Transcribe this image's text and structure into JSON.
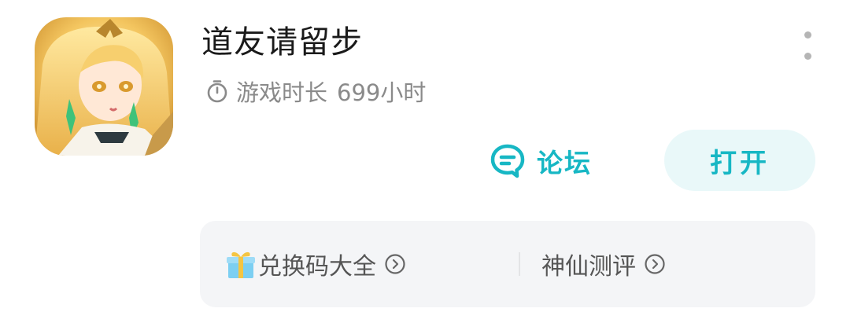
{
  "app": {
    "title": "道友请留步",
    "icon": "game-character-portrait",
    "playtime_label": "游戏时长",
    "playtime_value": "699小时"
  },
  "actions": {
    "forum_label": "论坛",
    "open_label": "打开"
  },
  "links": [
    {
      "label": "兑换码大全",
      "icon": "gift-icon"
    },
    {
      "label": "神仙测评",
      "icon": ""
    }
  ],
  "colors": {
    "accent": "#17b7c4",
    "open_button_bg": "#e9f8f9",
    "panel_bg": "#f4f5f7",
    "title": "#1a1a1a",
    "secondary_text": "#8a8a8a"
  }
}
